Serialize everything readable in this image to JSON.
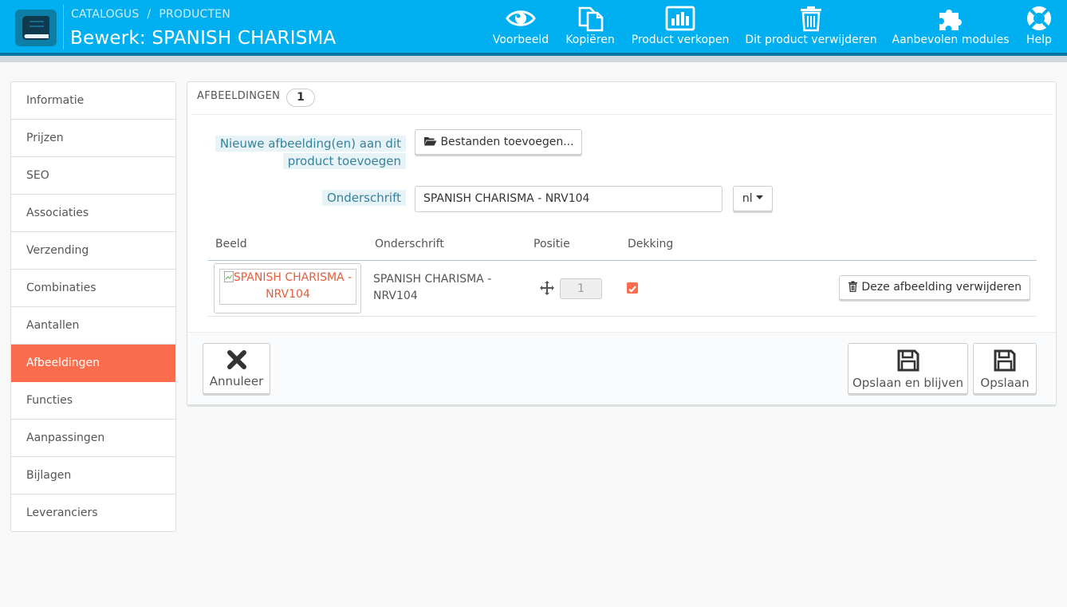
{
  "header": {
    "breadcrumb": [
      "CATALOGUS",
      "PRODUCTEN"
    ],
    "breadcrumb_separator": "/",
    "title": "Bewerk: SPANISH CHARISMA",
    "toolbar": [
      {
        "label": "Voorbeeld",
        "icon": "eye-icon"
      },
      {
        "label": "Kopiëren",
        "icon": "copy-icon"
      },
      {
        "label": "Product verkopen",
        "icon": "chart-icon"
      },
      {
        "label": "Dit product verwijderen",
        "icon": "trash-icon"
      },
      {
        "label": "Aanbevolen modules",
        "icon": "puzzle-icon"
      },
      {
        "label": "Help",
        "icon": "lifebuoy-icon"
      }
    ]
  },
  "sidebar": {
    "items": [
      {
        "label": "Informatie"
      },
      {
        "label": "Prijzen"
      },
      {
        "label": "SEO"
      },
      {
        "label": "Associaties"
      },
      {
        "label": "Verzending"
      },
      {
        "label": "Combinaties"
      },
      {
        "label": "Aantallen"
      },
      {
        "label": "Afbeeldingen",
        "active": true
      },
      {
        "label": "Functies"
      },
      {
        "label": "Aanpassingen"
      },
      {
        "label": "Bijlagen"
      },
      {
        "label": "Leveranciers"
      }
    ]
  },
  "panel": {
    "heading": "AFBEELDINGEN",
    "count": "1",
    "new_image_label_line1": "Nieuwe afbeelding(en) aan dit",
    "new_image_label_line2": "product toevoegen",
    "add_files_button": "Bestanden toevoegen...",
    "caption_label": "Onderschrift",
    "caption_value": "SPANISH CHARISMA - NRV104",
    "language": "nl",
    "table": {
      "columns": [
        "Beeld",
        "Onderschrift",
        "Positie",
        "Dekking"
      ],
      "rows": [
        {
          "image_alt": "SPANISH CHARISMA - NRV104",
          "caption_line1": "SPANISH CHARISMA -",
          "caption_line2": "NRV104",
          "position": "1",
          "cover": true,
          "delete_label": "Deze afbeelding verwijderen"
        }
      ]
    },
    "footer": {
      "cancel_label": "Annuleer",
      "save_stay_label": "Opslaan en blijven",
      "save_label": "Opslaan"
    }
  },
  "colors": {
    "header_bg": "#00aff0",
    "header_border": "#0077a3",
    "active_tab": "#fb6d4c",
    "label_text": "#34829c",
    "link_red": "#e55d3a"
  }
}
